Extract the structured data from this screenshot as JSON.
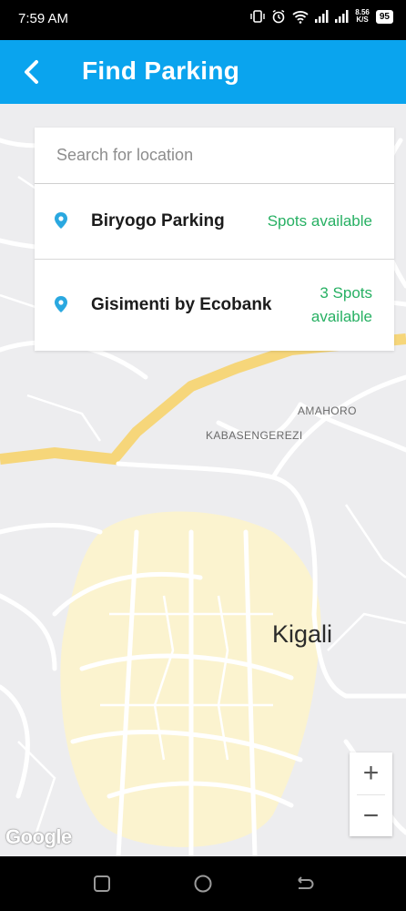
{
  "status_bar": {
    "time": "7:59 AM",
    "speed_value": "8.56",
    "speed_unit": "K/S",
    "battery": "95",
    "icons": [
      "vibrate-icon",
      "alarm-icon",
      "wifi-icon",
      "signal-icon",
      "signal-icon"
    ]
  },
  "app_bar": {
    "title": "Find Parking",
    "back_icon": "chevron-left-icon",
    "color": "#0aa4ee"
  },
  "search": {
    "placeholder": "Search for location"
  },
  "results": [
    {
      "name": "Biryogo Parking",
      "status": "Spots available",
      "icon": "map-pin-icon"
    },
    {
      "name": "Gisimenti by Ecobank",
      "status_lines": [
        "3 Spots",
        "available"
      ],
      "icon": "map-pin-icon"
    }
  ],
  "map": {
    "labels": {
      "amahoro": "AMAHORO",
      "kabasengerezi": "KABASENGEREZI",
      "city": "Kigali"
    },
    "attribution": "Google",
    "zoom_in": "+",
    "zoom_out": "−"
  },
  "colors": {
    "available": "#27b063",
    "pin": "#2aa8e0",
    "road_highlight": "#f6d67a"
  }
}
